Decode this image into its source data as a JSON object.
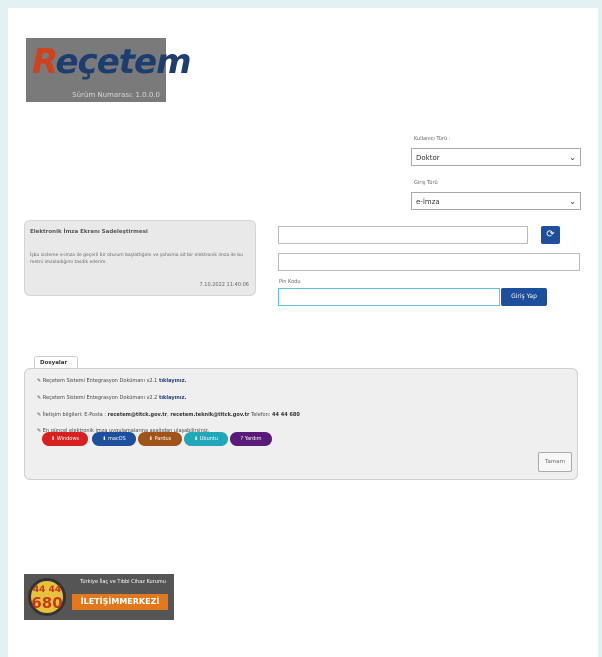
{
  "app": {
    "logo_text": "Reçetem",
    "version": "Sürüm Numarası: 1.0.0.0"
  },
  "login": {
    "user_type_label": "Kullanıcı Türü :",
    "user_type_value": "Doktor",
    "login_type_label": "Giriş Türü",
    "login_type_value": "e-İmza",
    "pin_label": "Pin Kodu",
    "login_button": "Giriş Yap",
    "refresh_icon": "refresh-icon"
  },
  "esign_info": {
    "title": "Elektronik İmza Ekranı Sadeleştirmesi",
    "text": "İşbu sisteme e-imza ile geçerli bir oturum başlattığımı ve şahsıma ait bir elektronik imza ile bu metni imzaladığımı tasdik ederim.",
    "date": "7.10.2022 11:40:06"
  },
  "documents": {
    "tab": "Dosyalar",
    "items": [
      {
        "text": "Reçetem Sistemi Entegrasyon Dokümanı v2.1",
        "link": "tıklayınız."
      },
      {
        "text": "Reçetem Sistemi Entegrasyon Dokümanı v2.2",
        "link": "tıklayınız."
      }
    ],
    "contact": {
      "prefix": "İletişim bilgileri: E-Posta :",
      "email1": "recetem@titck.gov.tr",
      "email2": "recetem.teknik@titck.gov.tr",
      "phone_label": "Telefon:",
      "phone": "44 44 680"
    },
    "esign_note": "En güncel elektronik imza uygulamalarına aşağıdan ulaşabilirsiniz.",
    "os_buttons": [
      {
        "label": "Windows",
        "color": "#d62020"
      },
      {
        "label": "macOS",
        "color": "#1e4f9c"
      },
      {
        "label": "Pardus",
        "color": "#a0541b"
      },
      {
        "label": "Ubuntu",
        "color": "#21a8b8"
      },
      {
        "label": "Yardım",
        "color": "#5a1a7a"
      }
    ],
    "close_button": "Tamam"
  },
  "call_center": {
    "number_top": "44 44",
    "number_bottom": "680",
    "tagline": "Türkiye İlaç ve Tıbbi Cihaz Kurumu",
    "main": "İLETİŞİMMERKEZİ"
  }
}
